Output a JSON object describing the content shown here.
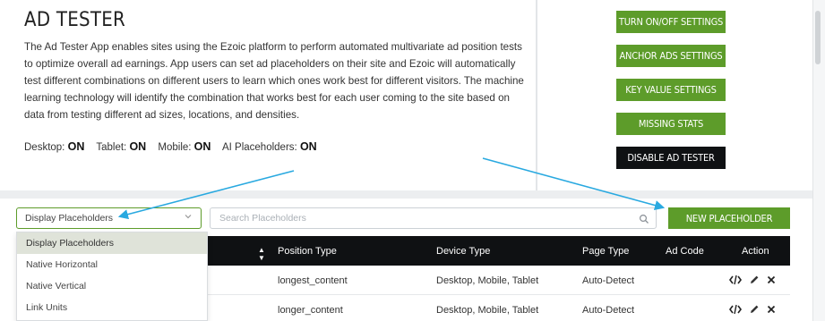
{
  "header": {
    "title": "AD TESTER",
    "description": "The Ad Tester App enables sites using the Ezoic platform to perform automated multivariate ad position tests to optimize overall ad earnings. App users can set ad placeholders on their site and Ezoic will automatically test different combinations on different users to learn which ones work best for different visitors. The machine learning technology will identify the combination that works best for each user coming to the site based on data from testing different ad sizes, locations, and densities."
  },
  "status": {
    "desktop_label": "Desktop:",
    "desktop_value": "ON",
    "tablet_label": "Tablet:",
    "tablet_value": "ON",
    "mobile_label": "Mobile:",
    "mobile_value": "ON",
    "ai_label": "AI Placeholders:",
    "ai_value": "ON"
  },
  "buttons": {
    "turn_onoff": "TURN ON/OFF SETTINGS",
    "anchor_ads": "ANCHOR ADS SETTINGS",
    "key_value": "KEY VALUE SETTINGS",
    "missing_stats": "MISSING STATS",
    "disable": "DISABLE AD TESTER"
  },
  "toolbar": {
    "select_value": "Display Placeholders",
    "search_placeholder": "Search Placeholders",
    "new_button": "NEW PLACEHOLDER"
  },
  "dropdown": {
    "options": [
      "Display Placeholders",
      "Native Horizontal",
      "Native Vertical",
      "Link Units"
    ]
  },
  "table": {
    "headers": {
      "position_type": "Position Type",
      "device_type": "Device Type",
      "page_type": "Page Type",
      "ad_code": "Ad Code",
      "action": "Action"
    },
    "rows": [
      {
        "position_type": "longest_content",
        "device_type": "Desktop, Mobile, Tablet",
        "page_type": "Auto-Detect"
      },
      {
        "position_type": "longer_content",
        "device_type": "Desktop, Mobile, Tablet",
        "page_type": "Auto-Detect"
      }
    ]
  },
  "colors": {
    "accent_green": "#5d9c2a",
    "dark": "#0f1113",
    "arrow": "#29a9e0"
  },
  "icons": [
    "chevron-down-icon",
    "search-icon",
    "sort-icon",
    "code-icon",
    "pencil-icon",
    "close-icon"
  ]
}
